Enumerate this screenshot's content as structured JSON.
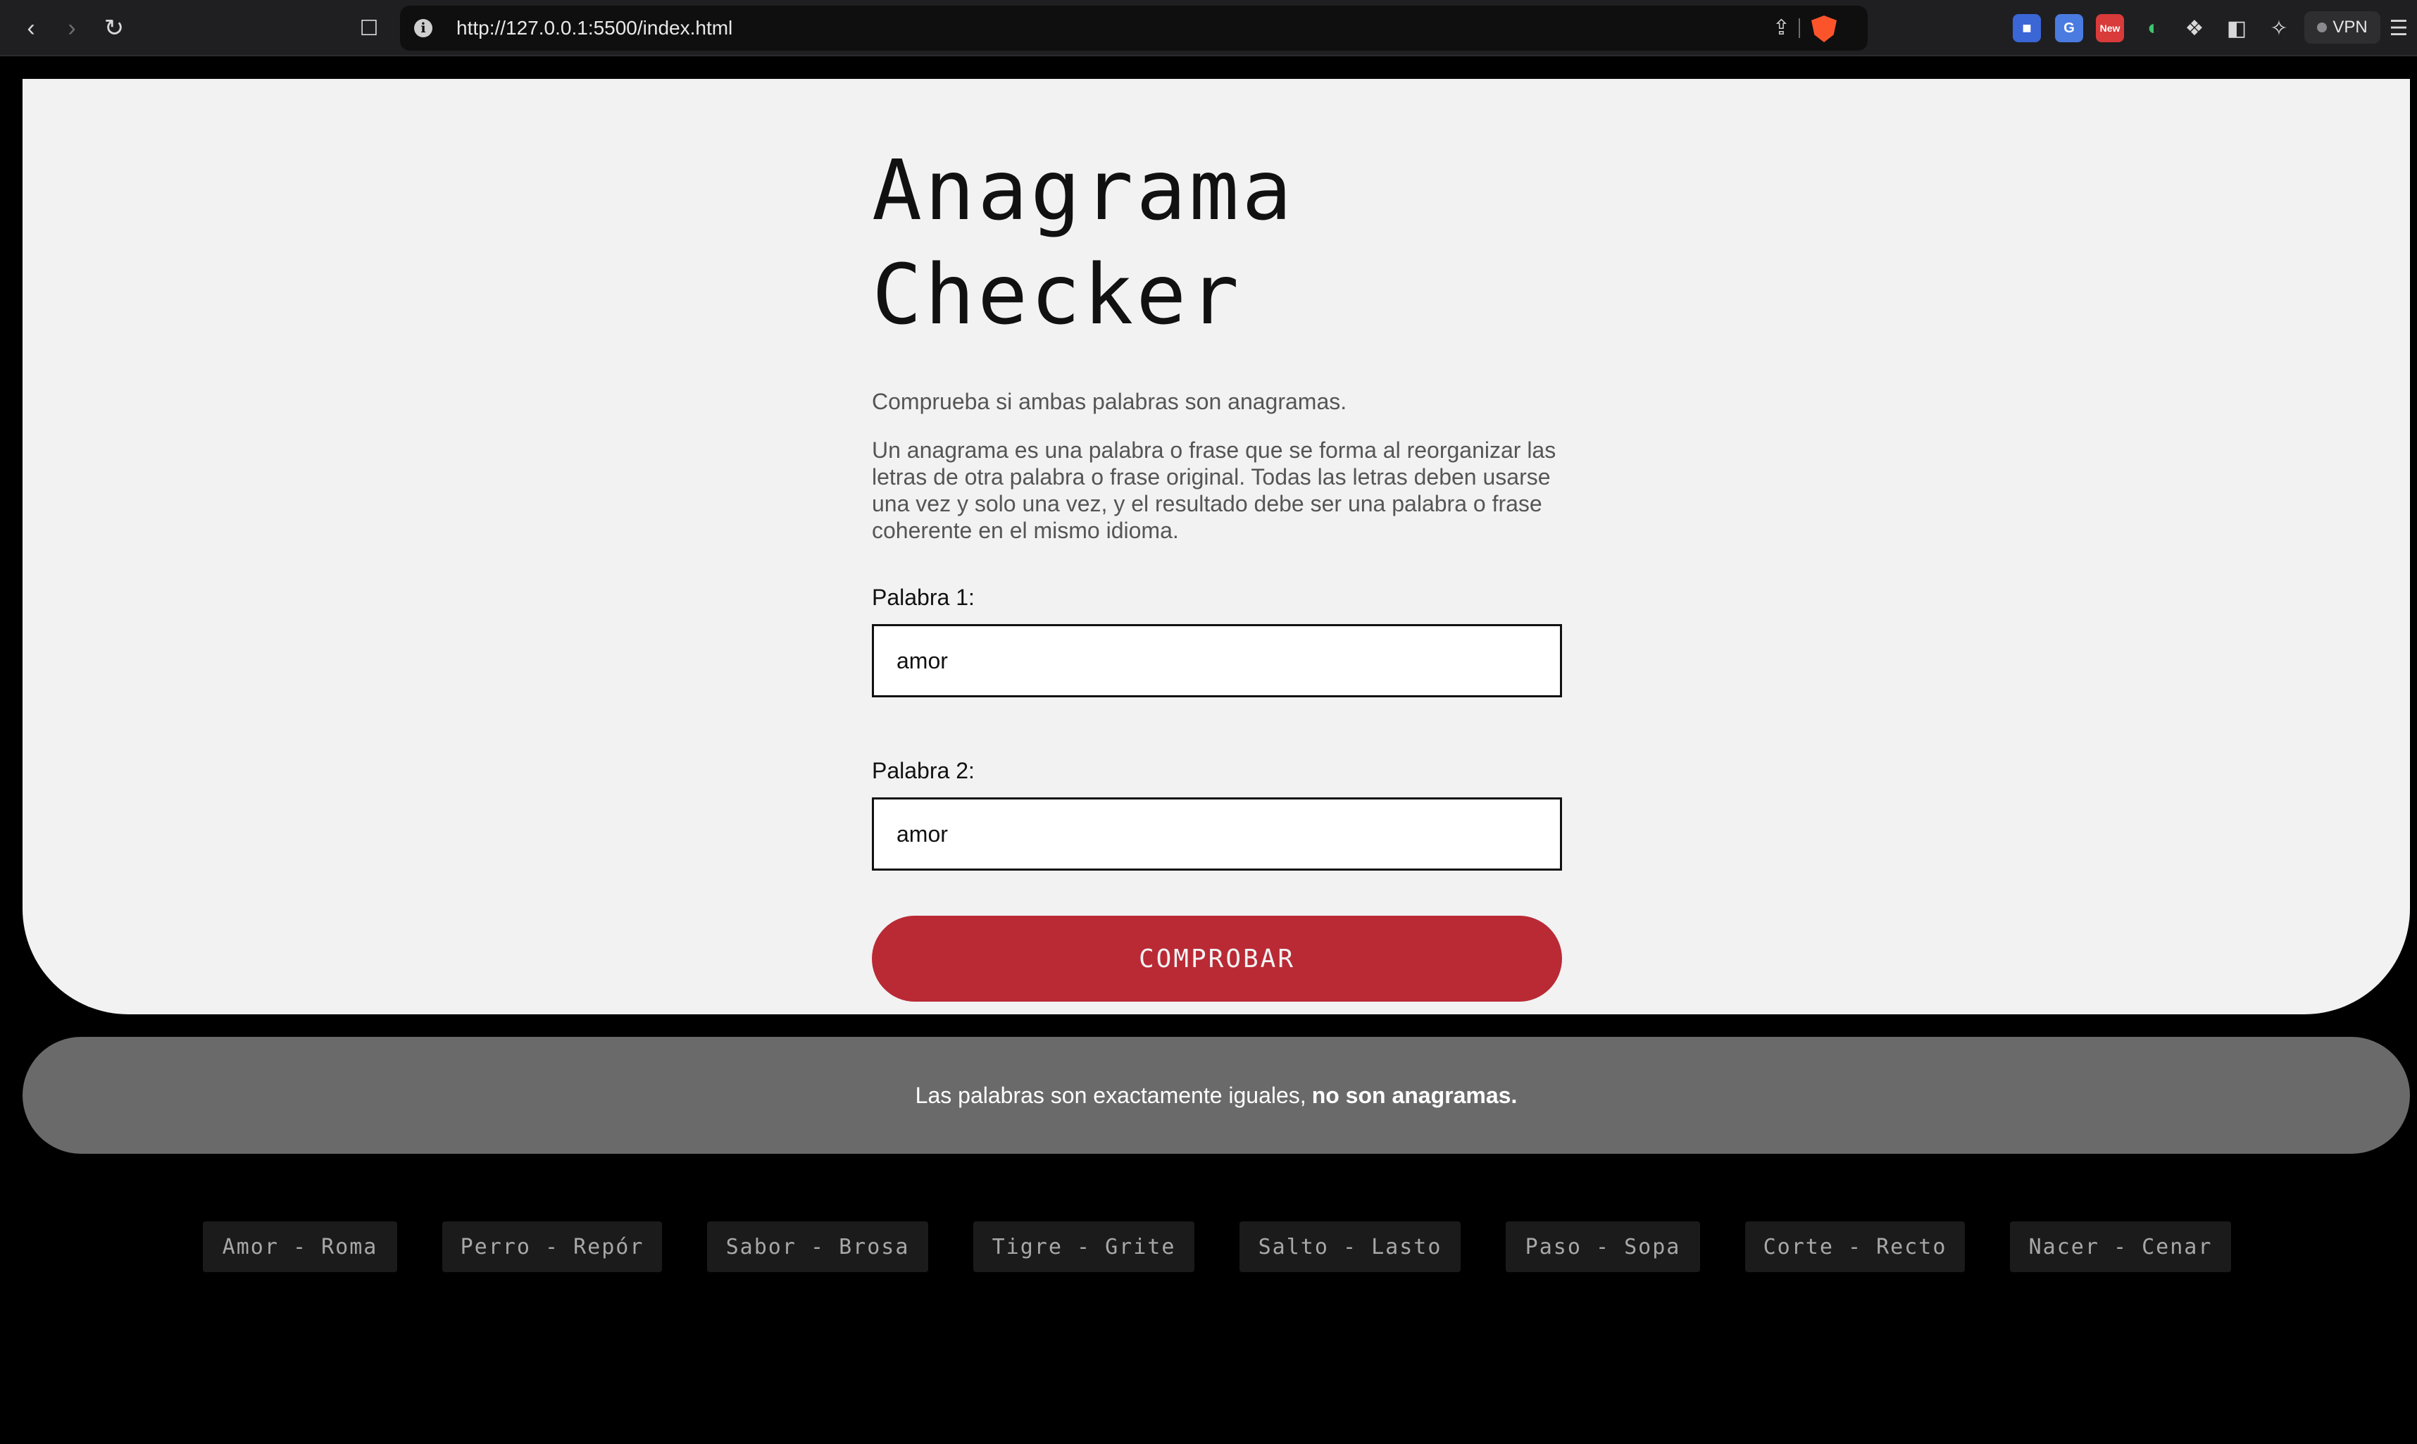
{
  "browser": {
    "url": "http://127.0.0.1:5500/index.html",
    "vpn_label": "VPN",
    "ext_new_badge": "New"
  },
  "page": {
    "title_line1": "Anagrama",
    "title_line2": "Checker",
    "subtitle": "Comprueba si ambas palabras son anagramas.",
    "description": "Un anagrama es una palabra o frase que se forma al reorganizar las letras de otra palabra o frase original. Todas las letras deben usarse una vez y solo una vez, y el resultado debe ser una palabra o frase coherente en el mismo idioma.",
    "word1_label": "Palabra 1:",
    "word1_value": "amor",
    "word2_label": "Palabra 2:",
    "word2_value": "amor",
    "button_label": "COMPROBAR",
    "accent_color": "#b92a35"
  },
  "result": {
    "message": "Las palabras son exactamente iguales,",
    "emphasis": "no son anagramas."
  },
  "examples": [
    "Amor - Roma",
    "Perro - Repór",
    "Sabor - Brosa",
    "Tigre - Grite",
    "Salto - Lasto",
    "Paso - Sopa",
    "Corte - Recto",
    "Nacer - Cenar"
  ]
}
